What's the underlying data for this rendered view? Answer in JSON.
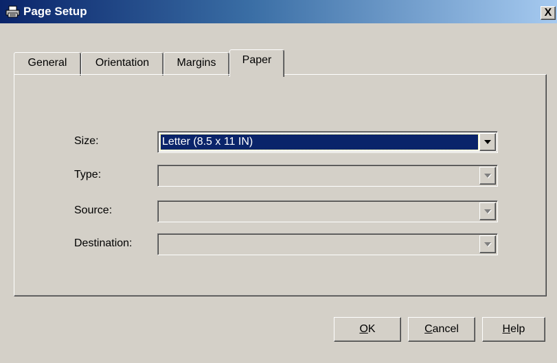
{
  "window": {
    "title": "Page Setup",
    "icon": "printer-icon",
    "close_label": "X"
  },
  "tabs": [
    {
      "label": "General",
      "active": false
    },
    {
      "label": "Orientation",
      "active": false
    },
    {
      "label": "Margins",
      "active": false
    },
    {
      "label": "Paper",
      "active": true
    }
  ],
  "form": {
    "size": {
      "label": "Size:",
      "value": "Letter (8.5 x 11 IN)",
      "enabled": true
    },
    "type": {
      "label": "Type:",
      "value": "",
      "enabled": false
    },
    "source": {
      "label": "Source:",
      "value": "",
      "enabled": false
    },
    "destination": {
      "label": "Destination:",
      "value": "",
      "enabled": false
    }
  },
  "buttons": {
    "ok": {
      "mnemonic": "O",
      "rest": "K"
    },
    "cancel": {
      "mnemonic": "C",
      "rest": "ancel"
    },
    "help": {
      "mnemonic": "H",
      "rest": "elp"
    }
  },
  "colors": {
    "face": "#d4d0c8",
    "titlebar_start": "#0a246a",
    "titlebar_end": "#a6caf0",
    "selection": "#0a246a"
  }
}
